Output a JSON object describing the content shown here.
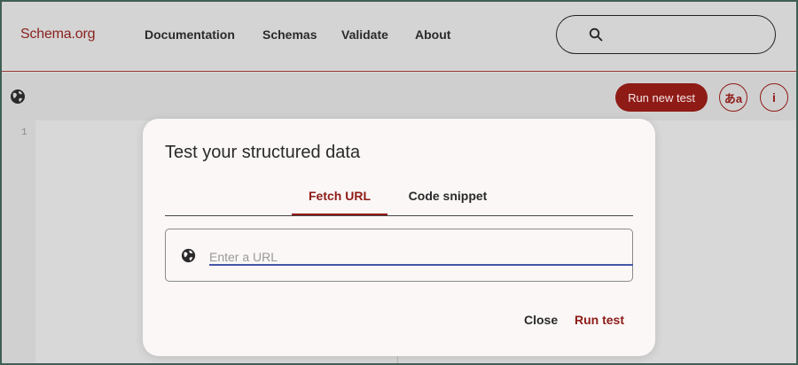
{
  "header": {
    "logo": "Schema.org",
    "nav": [
      "Documentation",
      "Schemas",
      "Validate",
      "About"
    ],
    "search_placeholder": ""
  },
  "toolbar": {
    "run_new_test": "Run new test",
    "lang_label": "あa",
    "info_label": "i"
  },
  "editor": {
    "line_number": "1"
  },
  "dialog": {
    "title": "Test your structured data",
    "tabs": [
      "Fetch URL",
      "Code snippet"
    ],
    "active_tab": "Fetch URL",
    "url_placeholder": "Enter a URL",
    "url_value": "",
    "close_label": "Close",
    "run_label": "Run test"
  },
  "colors": {
    "accent": "#8f1b17",
    "input_underline": "#4555a8"
  },
  "icons": {
    "toolbar_globe": "globe-icon",
    "search": "search-icon",
    "url_globe": "globe-icon"
  }
}
